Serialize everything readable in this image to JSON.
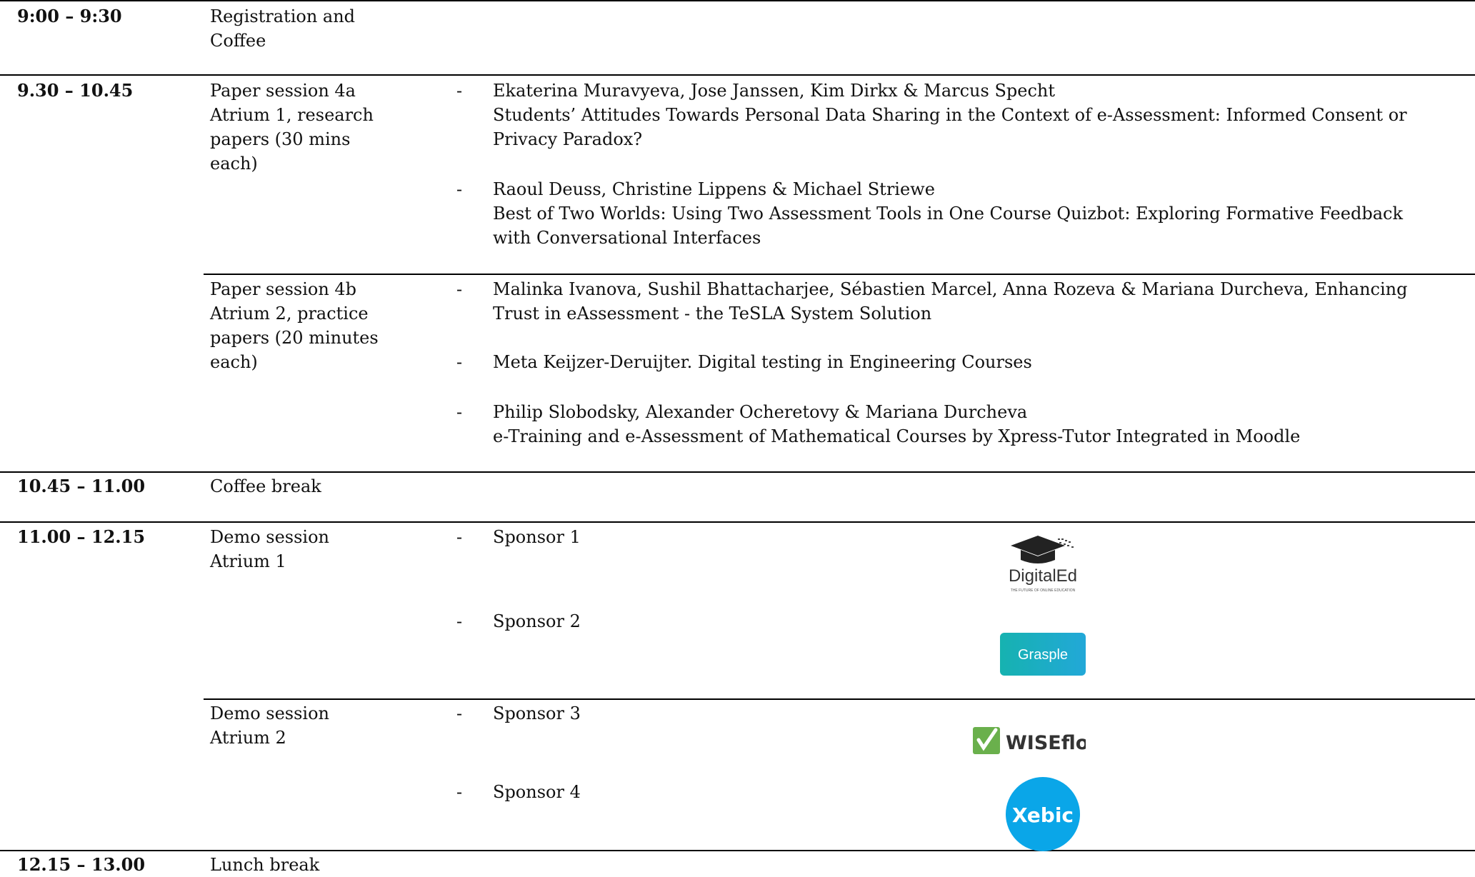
{
  "rows": [
    {
      "time": "9:00 – 9:30",
      "session": [
        "Registration and",
        "Coffee"
      ]
    },
    {
      "time": "9.30 – 10.45",
      "session_4a": [
        "Paper session 4a",
        "Atrium 1, research",
        "papers (30 mins",
        "each)"
      ],
      "items_4a": [
        {
          "lines": [
            "Ekaterina Muravyeva, Jose Janssen, Kim Dirkx & Marcus Specht",
            "Students’ Attitudes Towards Personal Data Sharing in the Context of e-Assessment: Informed Consent or",
            "Privacy Paradox?"
          ]
        },
        {
          "lines": [
            "Raoul Deuss, Christine Lippens & Michael Striewe",
            "Best of Two Worlds: Using Two Assessment Tools in One Course Quizbot: Exploring Formative Feedback",
            "with Conversational Interfaces"
          ]
        }
      ],
      "session_4b": [
        "Paper session 4b",
        "Atrium 2, practice",
        "papers (20 minutes",
        "each)"
      ],
      "items_4b": [
        {
          "lines": [
            "Malinka Ivanova, Sushil Bhattacharjee, Sébastien Marcel, Anna Rozeva & Mariana Durcheva, Enhancing",
            "Trust in eAssessment - the TeSLA System Solution"
          ]
        },
        {
          "lines": [
            "Meta Keijzer-Deruijter. Digital testing in Engineering Courses"
          ]
        },
        {
          "lines": [
            "Philip Slobodsky, Alexander Ocheretovy & Mariana Durcheva",
            "e-Training and e-Assessment of Mathematical Courses by Xpress-Tutor Integrated in Moodle"
          ]
        }
      ]
    },
    {
      "time": "10.45 – 11.00",
      "session": [
        "Coffee break"
      ]
    },
    {
      "time": "11.00 – 12.15",
      "demo1": [
        "Demo session",
        "Atrium 1"
      ],
      "demo1_items": [
        "Sponsor 1",
        "Sponsor 2"
      ],
      "demo2": [
        "Demo session",
        "Atrium 2"
      ],
      "demo2_items": [
        "Sponsor 3",
        "Sponsor 4"
      ]
    },
    {
      "time": "12.15 – 13.00",
      "session": [
        "Lunch break"
      ]
    }
  ],
  "dash": "-",
  "logos": {
    "digitaled": {
      "name": "DigitalEd",
      "tagline": "THE FUTURE OF ONLINE EDUCATION",
      "color": "#222222"
    },
    "grasple": {
      "name": "Grasple",
      "color": "#1fb0c9"
    },
    "wiseflow": {
      "name": "WISEflow",
      "color": "#6ab04c"
    },
    "xebic": {
      "name": "Xebic",
      "color": "#0aa6e8"
    }
  }
}
